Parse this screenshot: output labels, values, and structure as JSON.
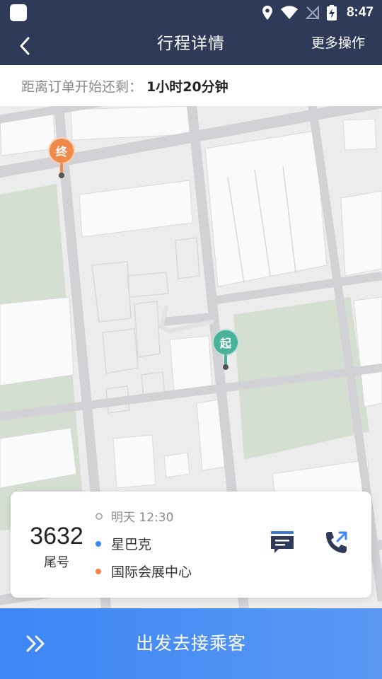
{
  "status_bar": {
    "time": "8:47"
  },
  "header": {
    "title": "行程详情",
    "more_actions": "更多操作",
    "back_icon": "chevron-left-icon"
  },
  "countdown": {
    "label": "距离订单开始还剩：",
    "value": "1小时20分钟"
  },
  "map": {
    "end_pin": {
      "label": "终",
      "color": "#f08a4b"
    },
    "start_pin": {
      "label": "起",
      "color": "#4ab19a"
    }
  },
  "trip_card": {
    "tail_number": "3632",
    "tail_label": "尾号",
    "time": "明天 12:30",
    "from": "星巴克",
    "to": "国际会展中心",
    "from_dot_color": "#3d86f5",
    "to_dot_color": "#f08a4b",
    "icon_color": "#2f3a59"
  },
  "action": {
    "label": "出发去接乘客",
    "icon": "double-chevron-right-icon"
  }
}
